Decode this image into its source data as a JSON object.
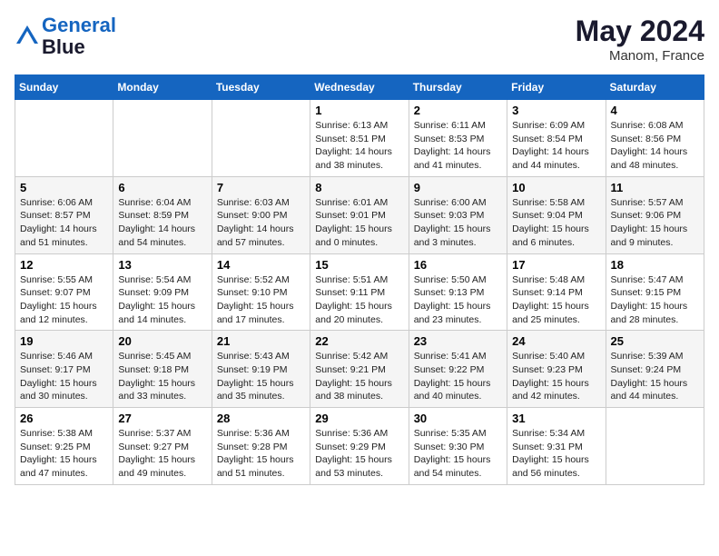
{
  "header": {
    "logo_line1": "General",
    "logo_line2": "Blue",
    "month_year": "May 2024",
    "location": "Manom, France"
  },
  "weekdays": [
    "Sunday",
    "Monday",
    "Tuesday",
    "Wednesday",
    "Thursday",
    "Friday",
    "Saturday"
  ],
  "weeks": [
    [
      {
        "day": "",
        "info": ""
      },
      {
        "day": "",
        "info": ""
      },
      {
        "day": "",
        "info": ""
      },
      {
        "day": "1",
        "info": "Sunrise: 6:13 AM\nSunset: 8:51 PM\nDaylight: 14 hours\nand 38 minutes."
      },
      {
        "day": "2",
        "info": "Sunrise: 6:11 AM\nSunset: 8:53 PM\nDaylight: 14 hours\nand 41 minutes."
      },
      {
        "day": "3",
        "info": "Sunrise: 6:09 AM\nSunset: 8:54 PM\nDaylight: 14 hours\nand 44 minutes."
      },
      {
        "day": "4",
        "info": "Sunrise: 6:08 AM\nSunset: 8:56 PM\nDaylight: 14 hours\nand 48 minutes."
      }
    ],
    [
      {
        "day": "5",
        "info": "Sunrise: 6:06 AM\nSunset: 8:57 PM\nDaylight: 14 hours\nand 51 minutes."
      },
      {
        "day": "6",
        "info": "Sunrise: 6:04 AM\nSunset: 8:59 PM\nDaylight: 14 hours\nand 54 minutes."
      },
      {
        "day": "7",
        "info": "Sunrise: 6:03 AM\nSunset: 9:00 PM\nDaylight: 14 hours\nand 57 minutes."
      },
      {
        "day": "8",
        "info": "Sunrise: 6:01 AM\nSunset: 9:01 PM\nDaylight: 15 hours\nand 0 minutes."
      },
      {
        "day": "9",
        "info": "Sunrise: 6:00 AM\nSunset: 9:03 PM\nDaylight: 15 hours\nand 3 minutes."
      },
      {
        "day": "10",
        "info": "Sunrise: 5:58 AM\nSunset: 9:04 PM\nDaylight: 15 hours\nand 6 minutes."
      },
      {
        "day": "11",
        "info": "Sunrise: 5:57 AM\nSunset: 9:06 PM\nDaylight: 15 hours\nand 9 minutes."
      }
    ],
    [
      {
        "day": "12",
        "info": "Sunrise: 5:55 AM\nSunset: 9:07 PM\nDaylight: 15 hours\nand 12 minutes."
      },
      {
        "day": "13",
        "info": "Sunrise: 5:54 AM\nSunset: 9:09 PM\nDaylight: 15 hours\nand 14 minutes."
      },
      {
        "day": "14",
        "info": "Sunrise: 5:52 AM\nSunset: 9:10 PM\nDaylight: 15 hours\nand 17 minutes."
      },
      {
        "day": "15",
        "info": "Sunrise: 5:51 AM\nSunset: 9:11 PM\nDaylight: 15 hours\nand 20 minutes."
      },
      {
        "day": "16",
        "info": "Sunrise: 5:50 AM\nSunset: 9:13 PM\nDaylight: 15 hours\nand 23 minutes."
      },
      {
        "day": "17",
        "info": "Sunrise: 5:48 AM\nSunset: 9:14 PM\nDaylight: 15 hours\nand 25 minutes."
      },
      {
        "day": "18",
        "info": "Sunrise: 5:47 AM\nSunset: 9:15 PM\nDaylight: 15 hours\nand 28 minutes."
      }
    ],
    [
      {
        "day": "19",
        "info": "Sunrise: 5:46 AM\nSunset: 9:17 PM\nDaylight: 15 hours\nand 30 minutes."
      },
      {
        "day": "20",
        "info": "Sunrise: 5:45 AM\nSunset: 9:18 PM\nDaylight: 15 hours\nand 33 minutes."
      },
      {
        "day": "21",
        "info": "Sunrise: 5:43 AM\nSunset: 9:19 PM\nDaylight: 15 hours\nand 35 minutes."
      },
      {
        "day": "22",
        "info": "Sunrise: 5:42 AM\nSunset: 9:21 PM\nDaylight: 15 hours\nand 38 minutes."
      },
      {
        "day": "23",
        "info": "Sunrise: 5:41 AM\nSunset: 9:22 PM\nDaylight: 15 hours\nand 40 minutes."
      },
      {
        "day": "24",
        "info": "Sunrise: 5:40 AM\nSunset: 9:23 PM\nDaylight: 15 hours\nand 42 minutes."
      },
      {
        "day": "25",
        "info": "Sunrise: 5:39 AM\nSunset: 9:24 PM\nDaylight: 15 hours\nand 44 minutes."
      }
    ],
    [
      {
        "day": "26",
        "info": "Sunrise: 5:38 AM\nSunset: 9:25 PM\nDaylight: 15 hours\nand 47 minutes."
      },
      {
        "day": "27",
        "info": "Sunrise: 5:37 AM\nSunset: 9:27 PM\nDaylight: 15 hours\nand 49 minutes."
      },
      {
        "day": "28",
        "info": "Sunrise: 5:36 AM\nSunset: 9:28 PM\nDaylight: 15 hours\nand 51 minutes."
      },
      {
        "day": "29",
        "info": "Sunrise: 5:36 AM\nSunset: 9:29 PM\nDaylight: 15 hours\nand 53 minutes."
      },
      {
        "day": "30",
        "info": "Sunrise: 5:35 AM\nSunset: 9:30 PM\nDaylight: 15 hours\nand 54 minutes."
      },
      {
        "day": "31",
        "info": "Sunrise: 5:34 AM\nSunset: 9:31 PM\nDaylight: 15 hours\nand 56 minutes."
      },
      {
        "day": "",
        "info": ""
      }
    ]
  ]
}
